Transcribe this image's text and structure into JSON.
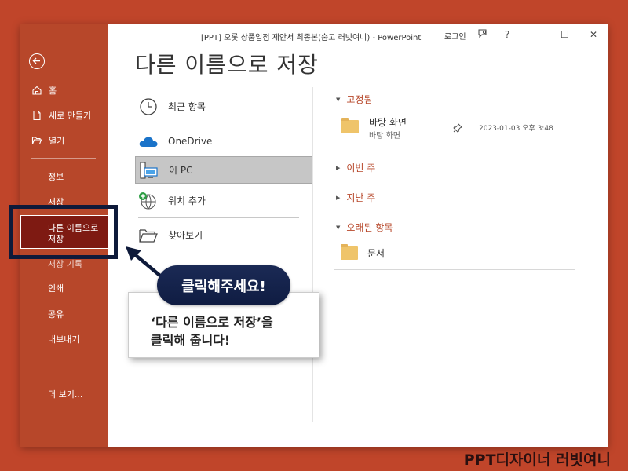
{
  "window": {
    "title": "[PPT] 오롯 상품입점 제안서 최종본(숨고 러빗여니)  -  PowerPoint",
    "login": "로그인",
    "help": "?",
    "minimize": "—",
    "maximize": "☐",
    "close": "✕"
  },
  "sidebar": {
    "home": "홈",
    "new": "새로 만들기",
    "open": "열기",
    "info": "정보",
    "save": "저장",
    "save_as": "다른 이름으로 저장",
    "history": "저장 기록",
    "print": "인쇄",
    "share": "공유",
    "export": "내보내기",
    "more": "더 보기..."
  },
  "main": {
    "heading": "다른 이름으로 저장",
    "locations": {
      "recent": "최근 항목",
      "onedrive": "OneDrive",
      "this_pc": "이 PC",
      "add_place": "위치 추가",
      "browse": "찾아보기"
    },
    "pinned": {
      "label": "고정됨",
      "item_name": "바탕 화면",
      "item_path": "바탕 화면",
      "item_date": "2023-01-03 오후 3:48"
    },
    "this_week": "이번 주",
    "last_week": "지난 주",
    "older": {
      "label": "오래된 항목",
      "item_name": "문서"
    }
  },
  "annotation": {
    "pill": "클릭해주세요!",
    "callout_line1": "‘다른 이름으로 저장’을",
    "callout_line2": "클릭해 줍니다!"
  },
  "brand": "PPT디자이너 러빗여니",
  "colors": {
    "background": "#c0452a",
    "sidebar": "#b7472a",
    "selected_sidebar_item": "#7e1a12",
    "highlight_box": "#0e1a3a",
    "section_header": "#b7472a"
  }
}
